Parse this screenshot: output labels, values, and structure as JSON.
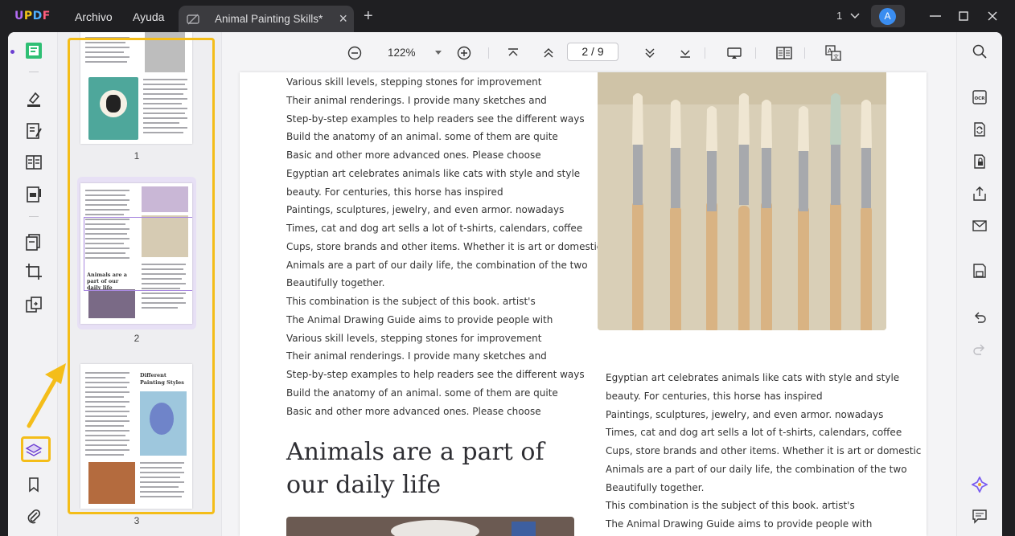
{
  "titlebar": {
    "logo": {
      "u": "U",
      "p": "P",
      "d": "D",
      "f": "F"
    },
    "menu_file": "Archivo",
    "menu_help": "Ayuda",
    "tab_title": "Animal Painting Skills*",
    "page_count_label": "1",
    "avatar_letter": "A"
  },
  "toolbar": {
    "zoom": "122%",
    "page_current": "2",
    "page_total": "9"
  },
  "thumbnails": {
    "page1": "1",
    "page2": "2",
    "page3": "3",
    "page2_heading": "Animals are a part of our daily life",
    "page3_heading": "Different Painting Styles"
  },
  "document": {
    "left_column": [
      "Various skill levels, stepping stones for improvement",
      "Their animal renderings. I provide many sketches and",
      "Step-by-step examples to help readers see the different ways",
      "Build the anatomy of an animal. some of them are quite",
      "Basic and other more advanced ones. Please choose",
      "Egyptian art celebrates animals like cats with style and style",
      "beauty. For centuries, this horse has inspired",
      "Paintings, sculptures, jewelry, and even armor. nowadays",
      "Times, cat and dog art sells a lot of t-shirts, calendars, coffee",
      "Cups, store brands and other items. Whether it is art or domestic",
      "Animals are a part of our daily life, the combination of the two",
      "Beautifully together.",
      "This combination is the subject of this book. artist's",
      "The Animal Drawing Guide aims to provide people with",
      "Various skill levels, stepping stones for improvement",
      "Their animal renderings. I provide many sketches and",
      "Step-by-step examples to help readers see the different ways",
      "Build the anatomy of an animal. some of them are quite",
      "Basic and other more advanced ones. Please choose"
    ],
    "heading_line1": "Animals are a part of",
    "heading_line2": "our daily life",
    "right_column": [
      "Egyptian art celebrates animals like cats with style and style",
      "beauty. For centuries, this horse has inspired",
      "Paintings, sculptures, jewelry, and even armor. nowadays",
      "Times, cat and dog art sells a lot of t-shirts, calendars, coffee",
      "Cups, store brands and other items. Whether it is art or domestic",
      "Animals are a part of our daily life, the combination of the two",
      "Beautifully together.",
      "This combination is the subject of this book. artist's",
      "The Animal Drawing Guide aims to provide people with"
    ]
  },
  "colors": {
    "highlight": "#f4bd19",
    "accent": "#6c3fd1",
    "avatar": "#3a8df0"
  }
}
